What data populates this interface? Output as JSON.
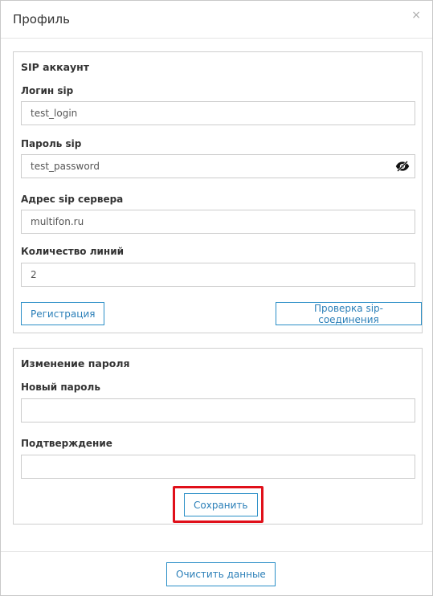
{
  "modal": {
    "title": "Профиль",
    "close_symbol": "×"
  },
  "sip_section": {
    "heading": "SIP аккаунт",
    "login_label": "Логин sip",
    "login_value": "test_login",
    "password_label": "Пароль sip",
    "password_value": "test_password",
    "password_toggle_icon": "eye-slash-icon",
    "server_label": "Адрес sip сервера",
    "server_value": "multifon.ru",
    "lines_label": "Количество линий",
    "lines_value": "2",
    "register_button": "Регистрация",
    "check_button": "Проверка sip-соединения"
  },
  "password_section": {
    "heading": "Изменение пароля",
    "new_password_label": "Новый пароль",
    "new_password_value": "",
    "confirm_label": "Подтверждение",
    "confirm_value": "",
    "save_button": "Сохранить"
  },
  "footer": {
    "clear_button": "Очистить данные"
  },
  "colors": {
    "accent": "#2b8fc7",
    "highlight": "#e0101a",
    "border": "#cccccc"
  }
}
